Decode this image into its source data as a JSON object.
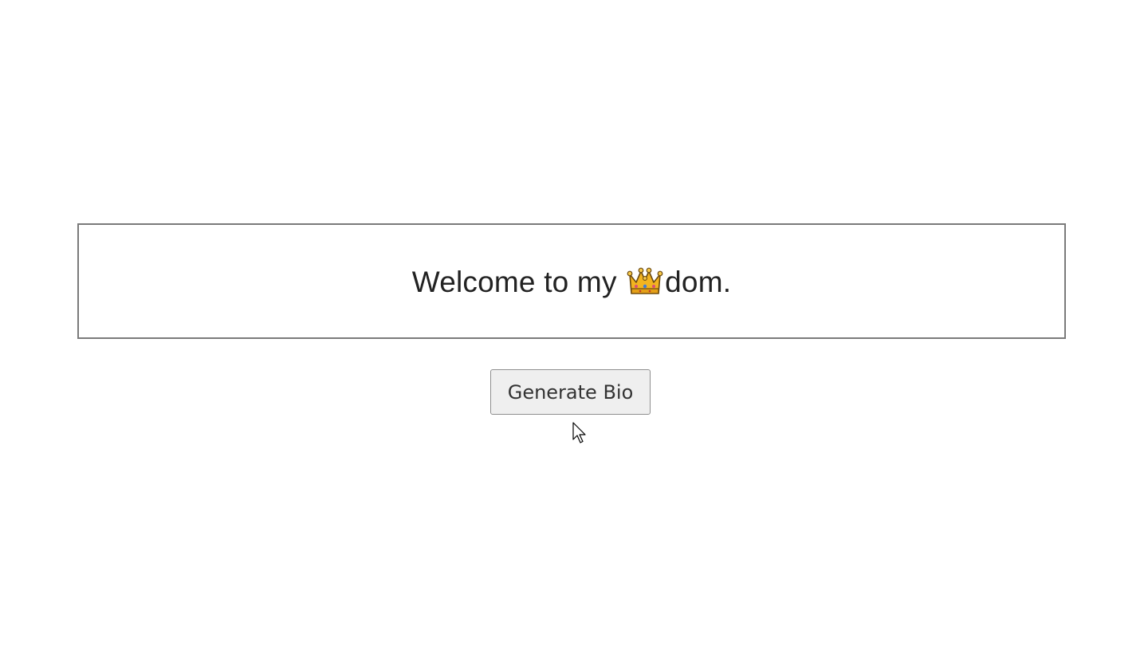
{
  "bio": {
    "text_before": "Welcome to my ",
    "emoji_icon": "crown-icon",
    "text_after": "dom."
  },
  "actions": {
    "generate_label": "Generate Bio"
  },
  "colors": {
    "border": "#7a7a7a",
    "text": "#222222",
    "button_bg": "#efefef",
    "crown_gold": "#f2b420",
    "crown_outline": "#6b4a12"
  }
}
